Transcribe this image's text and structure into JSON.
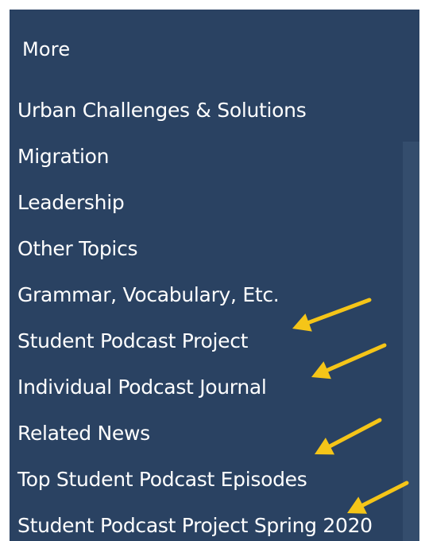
{
  "menu": {
    "header": "More",
    "items": [
      {
        "label": "Urban Challenges & Solutions"
      },
      {
        "label": "Migration"
      },
      {
        "label": "Leadership"
      },
      {
        "label": "Other Topics"
      },
      {
        "label": "Grammar, Vocabulary, Etc."
      },
      {
        "label": "Student Podcast Project"
      },
      {
        "label": "Individual Podcast Journal"
      },
      {
        "label": "Related News"
      },
      {
        "label": "Top Student Podcast Episodes"
      },
      {
        "label": "Student Podcast Project Spring 2020"
      }
    ]
  },
  "annotations": {
    "arrow_color": "#f5c518",
    "arrow_count": 4
  },
  "colors": {
    "panel_background": "#2a4262",
    "scrollbar_track": "#344d6d",
    "text": "#ffffff"
  }
}
